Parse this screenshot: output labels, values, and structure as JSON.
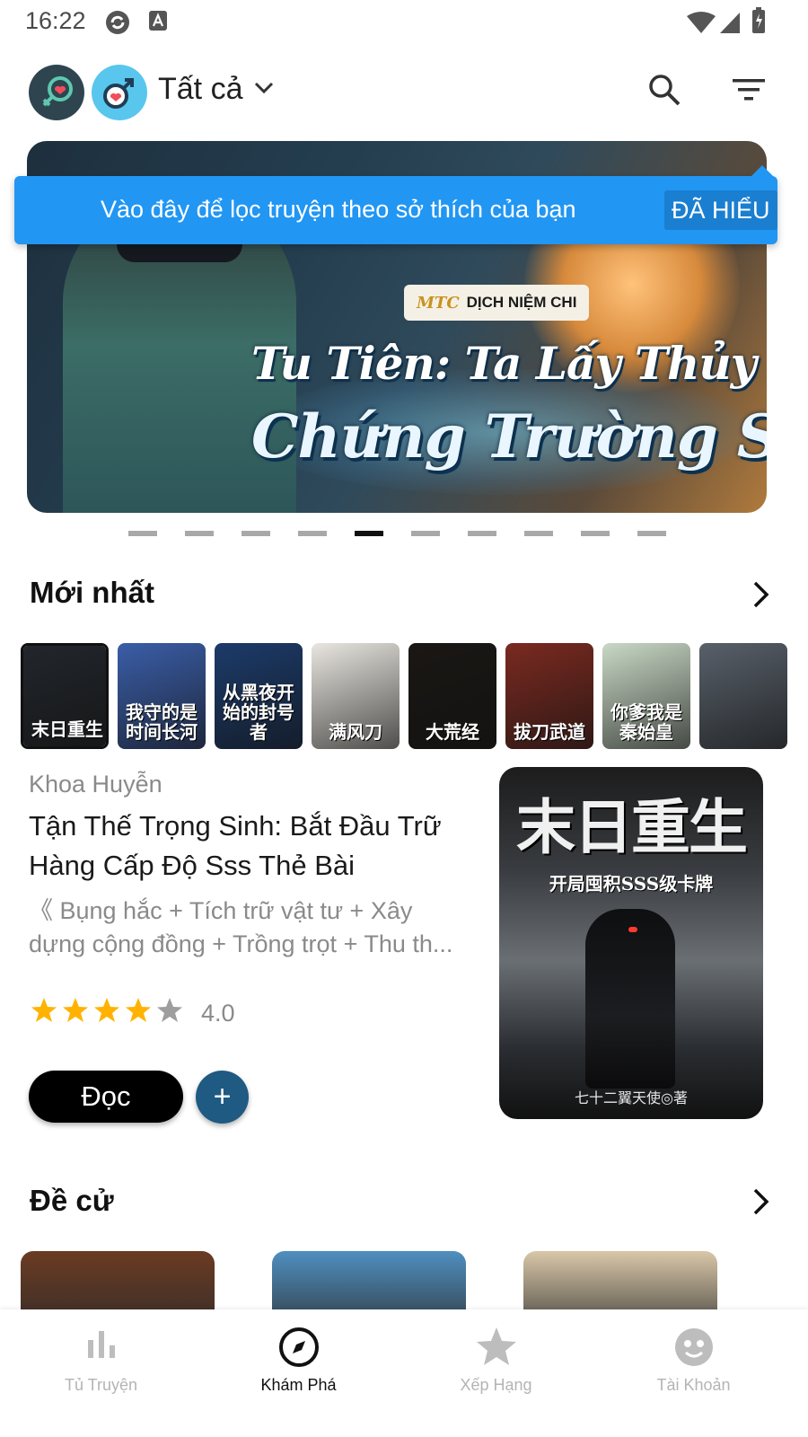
{
  "status_bar": {
    "time": "16:22",
    "icons": [
      "sync-icon",
      "accessibility-icon",
      "wifi-icon",
      "signal-icon",
      "battery-icon"
    ]
  },
  "top_bar": {
    "filter_label": "Tất cả",
    "icons": [
      "gender-female-icon",
      "gender-male-icon",
      "chevron-down-icon",
      "search-icon",
      "sort-icon"
    ]
  },
  "banner": {
    "tag_logo": "MTC",
    "tag": "DỊCH NIỆM CHI",
    "title_line1": "Tu Tiên: Ta Lấy Thủy Pháp",
    "title_line2": "Chứng Trường Sinh",
    "indicator_count": 10,
    "active_index": 4
  },
  "tooltip": {
    "text": "Vào đây để lọc truyện theo sở thích của bạn",
    "button": "ĐÃ HIỂU"
  },
  "sections": {
    "newest": {
      "title": "Mới nhất"
    },
    "recommended": {
      "title": "Đề cử"
    }
  },
  "newest_covers": [
    {
      "text": "末日重生",
      "color": "#22262b",
      "selected": true
    },
    {
      "text": "我守的是时间长河",
      "color": "#3b5ea8"
    },
    {
      "text": "从黑夜开始的封号者",
      "color": "#1c3b6a"
    },
    {
      "text": "满风刀",
      "color": "#e9e6e0"
    },
    {
      "text": "大荒经",
      "color": "#1a1714"
    },
    {
      "text": "拔刀武道",
      "color": "#7a2a20"
    },
    {
      "text": "你爹我是秦始皇",
      "color": "#c9d9c6"
    },
    {
      "text": "",
      "color": "#58606a"
    }
  ],
  "featured": {
    "author": "Khoa Huyễn",
    "title": "Tận Thế Trọng Sinh: Bắt Đầu Trữ Hàng Cấp Độ Sss Thẻ Bài",
    "description": "《 Bụng hắc + Tích trữ vật tư + Xây dựng cộng đồng + Trồng trọt + Thu th...",
    "rating": 4.0,
    "rating_text": "4.0",
    "read_label": "Đọc",
    "add_label": "+",
    "cover_title": "末日重生",
    "cover_subtitle": "开局囤积SSS级卡牌",
    "cover_author": "七十二翼天使◎著"
  },
  "recommended_cards": [
    {
      "color": "#6b3b22"
    },
    {
      "color": "#4f8fc0"
    },
    {
      "color": "#d9c7a8"
    }
  ],
  "bottom_nav": [
    {
      "label": "Tủ Truyện",
      "icon": "bar-chart-icon",
      "active": false
    },
    {
      "label": "Khám Phá",
      "icon": "compass-icon",
      "active": true
    },
    {
      "label": "Xếp Hạng",
      "icon": "star-icon",
      "active": false
    },
    {
      "label": "Tài Khoản",
      "icon": "account-face-icon",
      "active": false
    }
  ],
  "colors": {
    "tooltip_blue": "#2196f3",
    "add_button": "#1e5a82",
    "star_gold": "#ffb300",
    "star_gray": "#9e9e9e"
  }
}
